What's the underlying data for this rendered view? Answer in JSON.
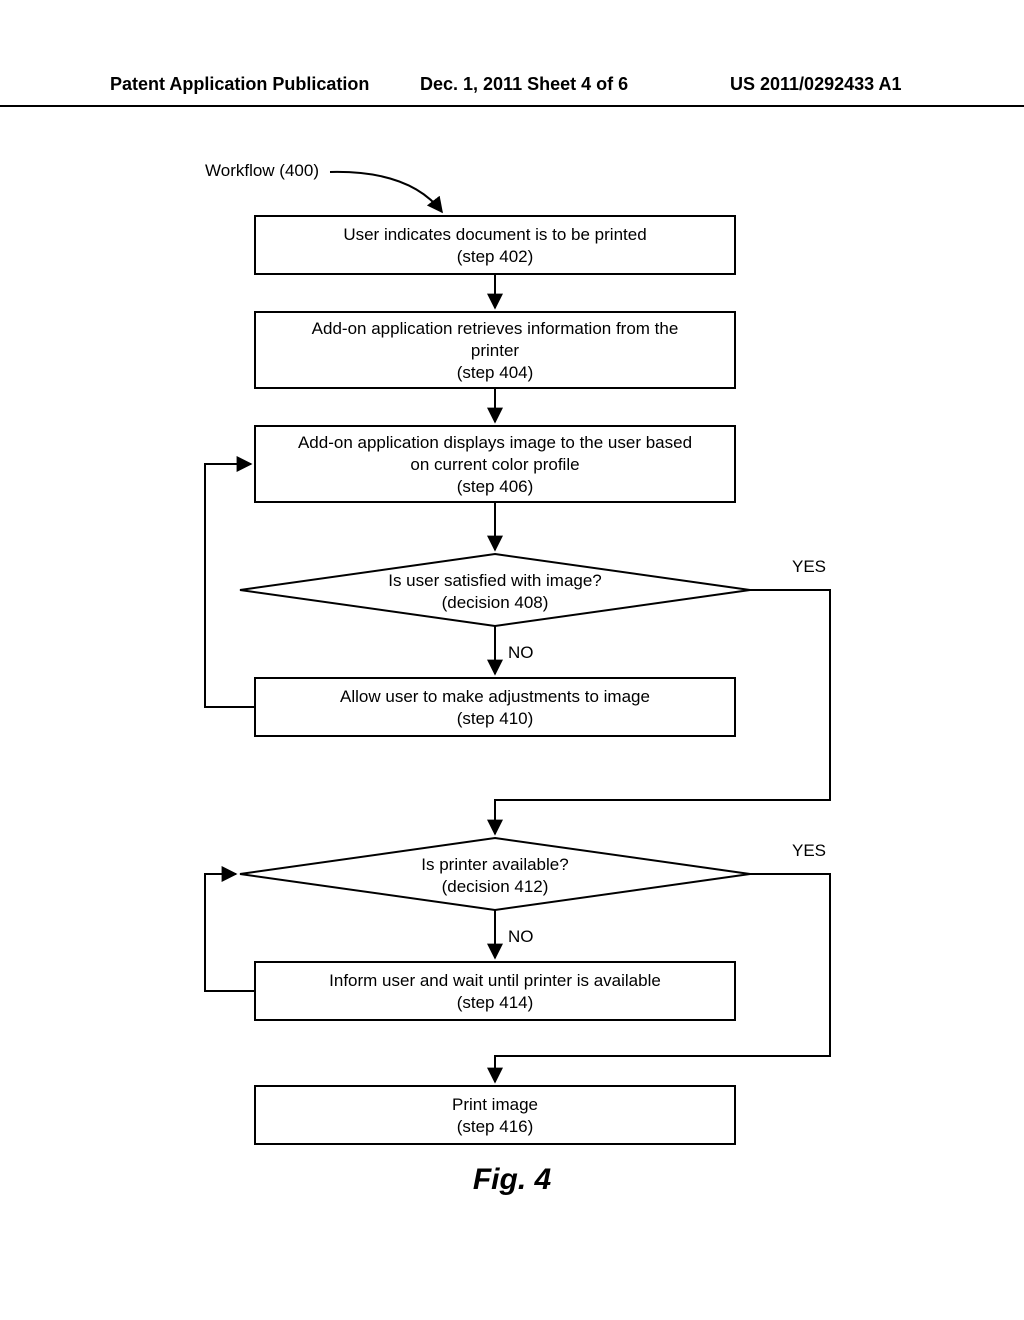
{
  "header": {
    "left": "Patent Application Publication",
    "center": "Dec. 1, 2011   Sheet 4 of 6",
    "right": "US 2011/0292433 A1"
  },
  "workflow_label": "Workflow (400)",
  "steps": {
    "s402_l1": "User indicates document is to be printed",
    "s402_l2": "(step 402)",
    "s404_l1": "Add-on application retrieves information from the",
    "s404_l2": "printer",
    "s404_l3": "(step 404)",
    "s406_l1": "Add-on application displays image to the user based",
    "s406_l2": "on current color profile",
    "s406_l3": "(step 406)",
    "d408_l1": "Is user satisfied with image?",
    "d408_l2": "(decision 408)",
    "s410_l1": "Allow user to make adjustments to image",
    "s410_l2": "(step 410)",
    "d412_l1": "Is printer available?",
    "d412_l2": "(decision 412)",
    "s414_l1": "Inform user and wait until printer is available",
    "s414_l2": "(step 414)",
    "s416_l1": "Print image",
    "s416_l2": "(step 416)"
  },
  "labels": {
    "yes": "YES",
    "no": "NO"
  },
  "caption": "Fig. 4"
}
